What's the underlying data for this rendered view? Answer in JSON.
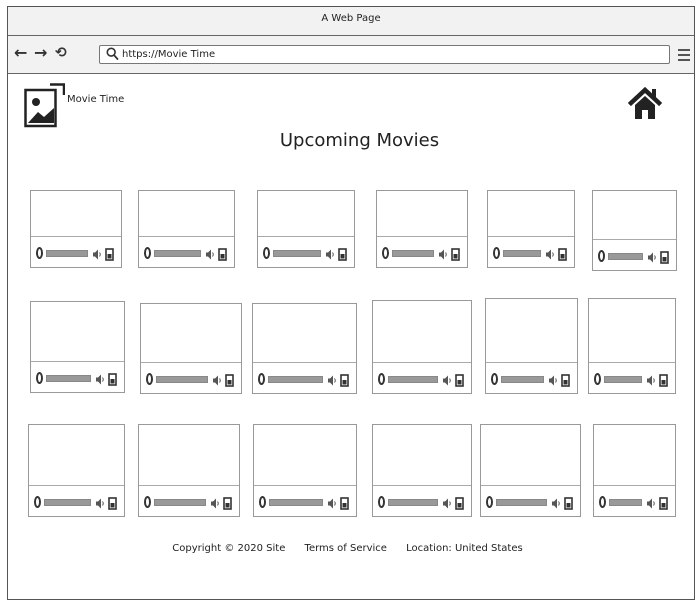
{
  "window": {
    "title": "A Web Page"
  },
  "browser": {
    "address_prefix": "https://",
    "address_value": "Movie Time",
    "back_icon": "back-arrow-icon",
    "forward_icon": "forward-arrow-icon",
    "reload_icon": "reload-icon",
    "menu_icon": "hamburger-menu-icon"
  },
  "header": {
    "site_name": "Movie Time",
    "logo_icon": "image-placeholder-icon",
    "home_icon": "home-icon"
  },
  "main": {
    "title": "Upcoming Movies",
    "player_count": 18,
    "player_controls": [
      "play-icon",
      "seek-bar",
      "volume-icon",
      "fullscreen-icon"
    ]
  },
  "footer": {
    "copyright": "Copyright © 2020 Site",
    "terms": "Terms of Service",
    "location": "Location: United States"
  },
  "colors": {
    "border": "#555555",
    "chrome": "#f2f2f2",
    "seek": "#999999",
    "icon": "#333333"
  }
}
